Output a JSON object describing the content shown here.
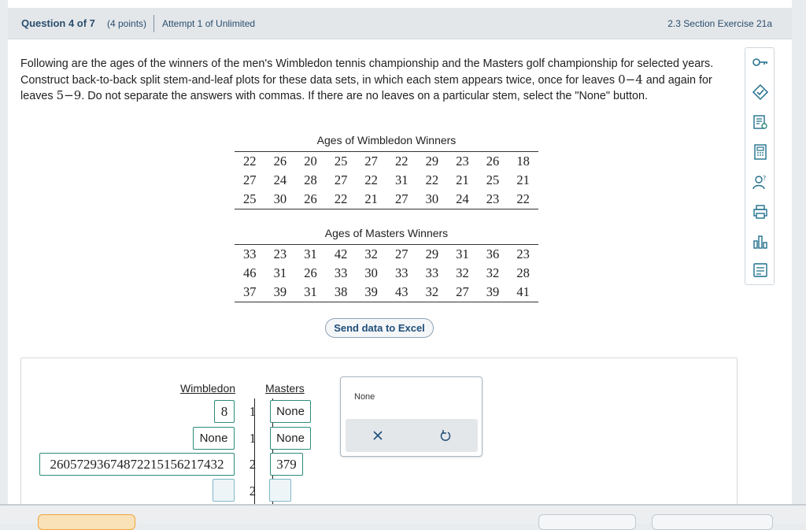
{
  "header": {
    "question": "Question 4 of 7",
    "points": "(4 points)",
    "attempt": "Attempt 1 of Unlimited",
    "section": "2.3 Section Exercise 21a"
  },
  "prompt": {
    "part1": "Following are the ages of the winners of the men's Wimbledon tennis championship and the Masters golf championship for selected years. Construct back-to-back split stem-and-leaf plots for these data sets, in which each stem appears twice, once for leaves ",
    "range1": "0−4",
    "part2": " and again for leaves ",
    "range2": "5−9",
    "part3": ". Do not separate the answers with commas. If there are no leaves on a particular stem, select the \"None\" button."
  },
  "wimbledon": {
    "title": "Ages of Wimbledon Winners",
    "rows": [
      [
        "22",
        "26",
        "20",
        "25",
        "27",
        "22",
        "29",
        "23",
        "26",
        "18"
      ],
      [
        "27",
        "24",
        "28",
        "27",
        "22",
        "31",
        "22",
        "21",
        "25",
        "21"
      ],
      [
        "25",
        "30",
        "26",
        "22",
        "21",
        "27",
        "30",
        "24",
        "23",
        "22"
      ]
    ]
  },
  "masters": {
    "title": "Ages of Masters Winners",
    "rows": [
      [
        "33",
        "23",
        "31",
        "42",
        "32",
        "27",
        "29",
        "31",
        "36",
        "23"
      ],
      [
        "46",
        "31",
        "26",
        "33",
        "30",
        "33",
        "33",
        "32",
        "32",
        "28"
      ],
      [
        "37",
        "39",
        "31",
        "38",
        "39",
        "43",
        "32",
        "27",
        "39",
        "41"
      ]
    ]
  },
  "excel_button": "Send data to Excel",
  "plot": {
    "left_header": "Wimbledon",
    "right_header": "Masters",
    "stems": [
      "1",
      "1",
      "2",
      "2"
    ],
    "left_answers": [
      "8",
      "None",
      "2605729367487221515621743​2",
      ""
    ],
    "right_answers": [
      "None",
      "None",
      "379",
      ""
    ]
  },
  "popup": {
    "none_label": "None"
  },
  "toolbar_icons": [
    "key-icon",
    "tag-icon",
    "notes-icon",
    "calculator-icon",
    "help-person-icon",
    "print-icon",
    "chart-icon",
    "worksheet-icon"
  ]
}
